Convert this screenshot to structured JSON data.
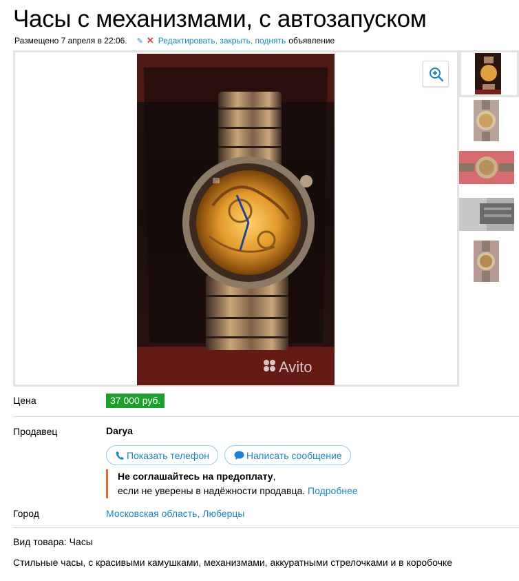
{
  "listing": {
    "title": "Часы с механизмами, с автозапуском",
    "posted": "Размещено 7 апреля в 22:06.",
    "edit_link": "Редактировать, закрыть, поднять",
    "edit_suffix": "объявление"
  },
  "gallery": {
    "watermark": "Avito",
    "thumbnails_count": 5,
    "active_thumbnail": 1
  },
  "price": {
    "label": "Цена",
    "value": "37 000 руб."
  },
  "seller": {
    "label": "Продавец",
    "name": "Darya",
    "show_phone": "Показать телефон",
    "write_message": "Написать сообщение"
  },
  "warning": {
    "bold": "Не соглашайтесь на предоплату",
    "comma": ",",
    "text": "если не уверены в надёжности продавца.",
    "more": "Подробнее"
  },
  "city": {
    "label": "Город",
    "value": "Московская область, Люберцы"
  },
  "item": {
    "kind": "Вид товара: Часы",
    "description": "Стильные часы, с красивыми камушками, механизмами, аккуратными стрелочками и в коробочке"
  },
  "colors": {
    "link": "#1a84cf",
    "price_bg": "#19a02d",
    "warning_bar": "#e8692f",
    "delete": "#e03a3a"
  }
}
